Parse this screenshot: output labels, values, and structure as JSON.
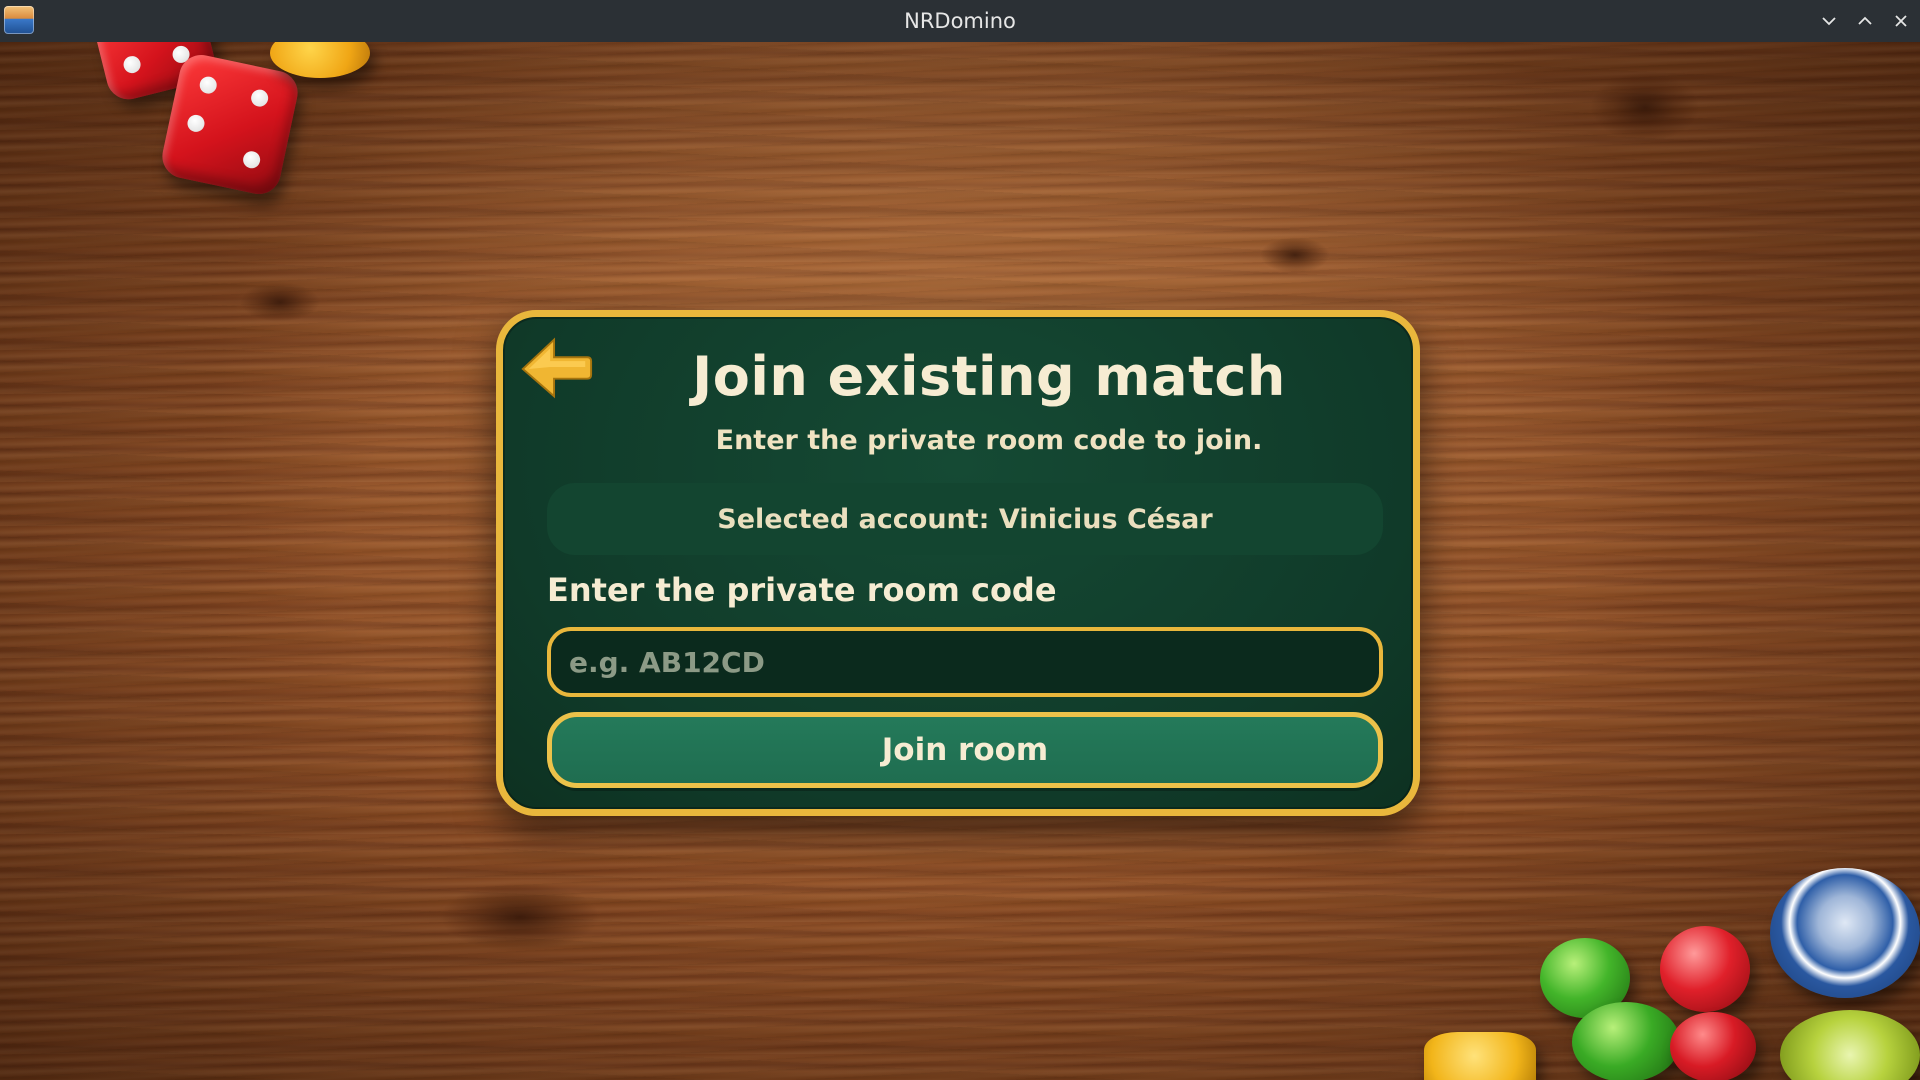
{
  "window": {
    "title": "NRDomino"
  },
  "dialog": {
    "title": "Join existing match",
    "subtitle": "Enter the private room code to join.",
    "selected_account": "Selected account: Vinicius César",
    "room_code_label": "Enter the private room code",
    "room_code_placeholder": "e.g. AB12CD",
    "room_code_value": "",
    "join_button_label": "Join room"
  },
  "colors": {
    "panel_background": "#103a29",
    "panel_border": "#e9b73c",
    "button_fill": "#247a5a",
    "text_cream": "#f6ecd2"
  },
  "icons": {
    "app": "app-logo-icon",
    "minimize": "chevron-down-icon",
    "maximize": "chevron-up-icon",
    "close": "close-icon",
    "back": "back-arrow-icon"
  }
}
